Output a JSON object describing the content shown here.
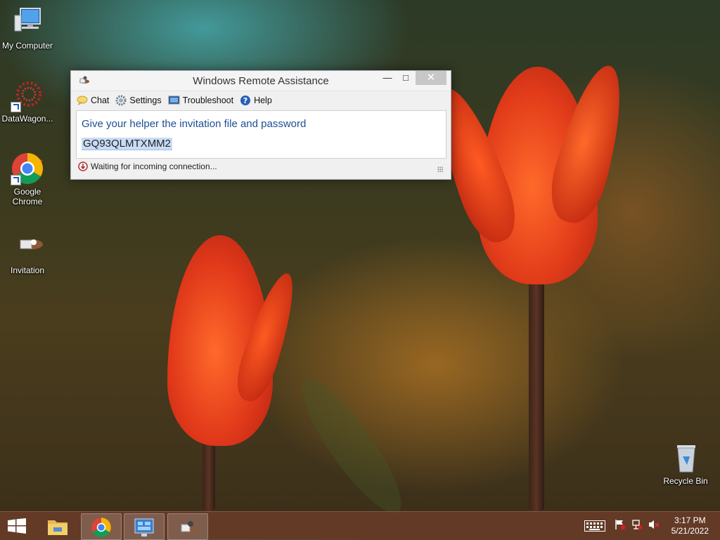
{
  "desktop": {
    "icons": [
      {
        "label": "My Computer",
        "icon": "computer-icon"
      },
      {
        "label": "DataWagon...",
        "icon": "datawagon-icon"
      },
      {
        "label": "Google Chrome",
        "icon": "chrome-icon"
      },
      {
        "label": "Invitation",
        "icon": "invitation-icon"
      },
      {
        "label": "Recycle Bin",
        "icon": "recycle-bin-icon"
      }
    ]
  },
  "window": {
    "title": "Windows Remote Assistance",
    "toolbar": {
      "chat": "Chat",
      "settings": "Settings",
      "troubleshoot": "Troubleshoot",
      "help": "Help"
    },
    "heading": "Give your helper the invitation file and password",
    "password": "GQ93QLMTXMM2",
    "status": "Waiting for incoming connection..."
  },
  "taskbar": {
    "time": "3:17 PM",
    "date": "5/21/2022",
    "accent": "#6e3e2a"
  }
}
